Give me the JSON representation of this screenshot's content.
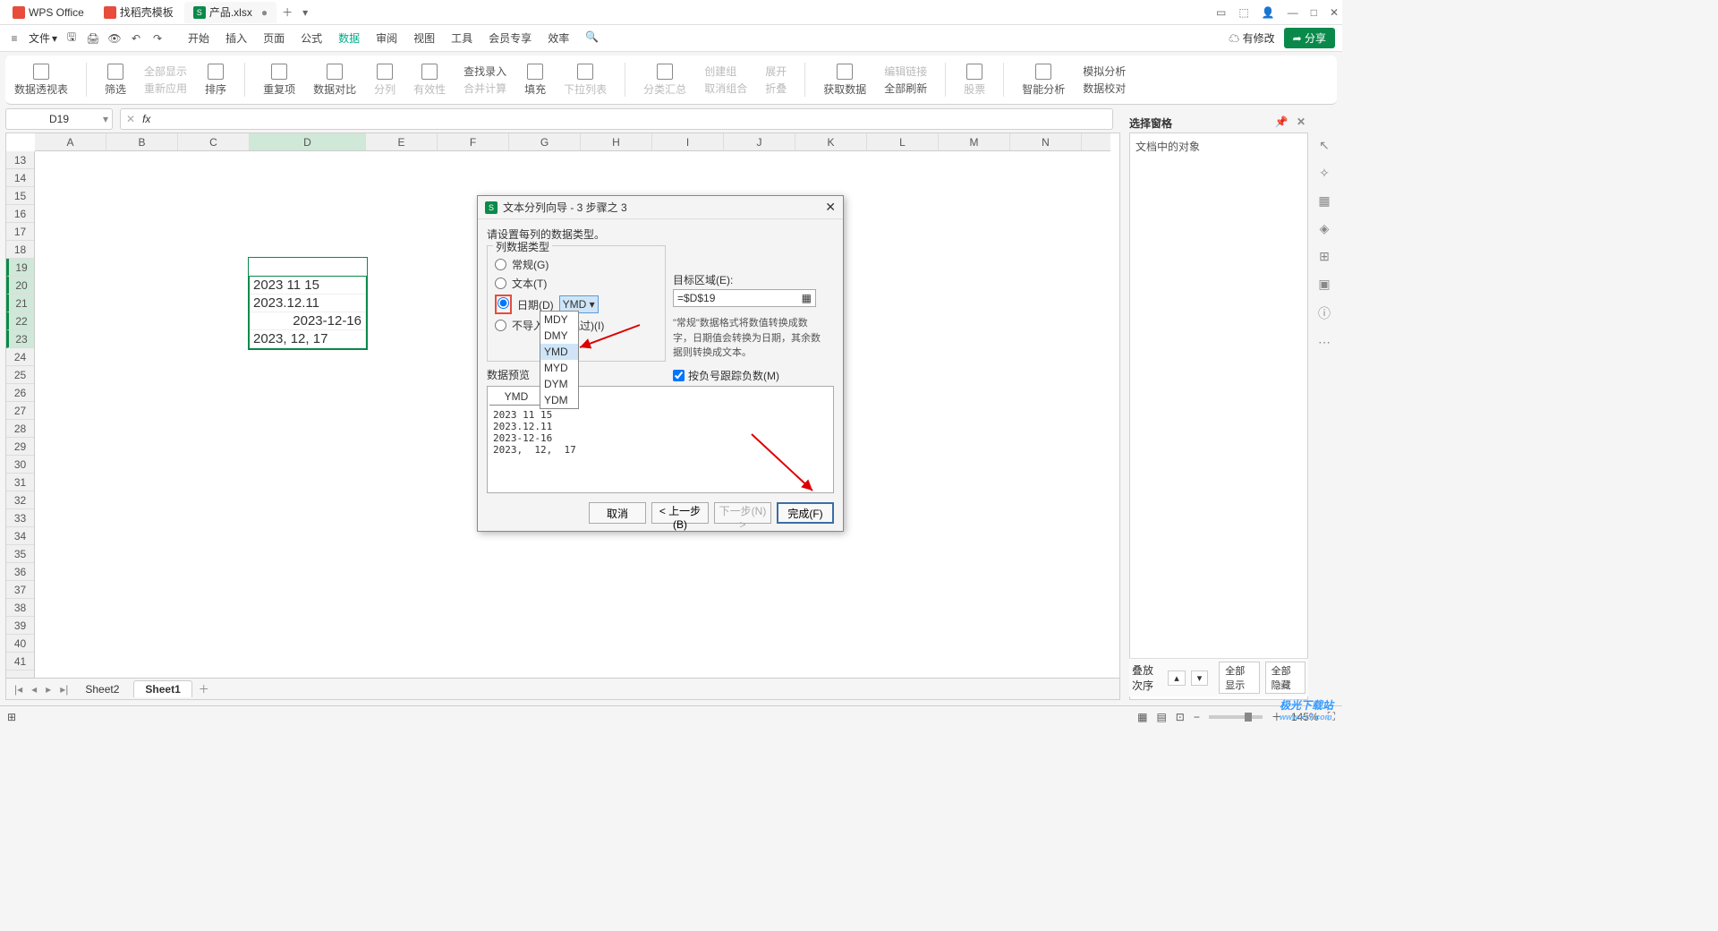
{
  "titlebar": {
    "tabs": [
      {
        "label": "WPS Office"
      },
      {
        "label": "找稻壳模板"
      },
      {
        "label": "产品.xlsx"
      }
    ],
    "modified": "●"
  },
  "menubar": {
    "file": "文件",
    "items": [
      "开始",
      "插入",
      "页面",
      "公式",
      "数据",
      "审阅",
      "视图",
      "工具",
      "会员专享",
      "效率"
    ],
    "active_index": 4,
    "pending": "有修改",
    "share": "分享"
  },
  "ribbon": {
    "g1": "数据透视表",
    "g2a": "筛选",
    "g2b": "全部显示",
    "g2c": "重新应用",
    "g3": "排序",
    "g4": "重复项",
    "g5": "数据对比",
    "g6": "分列",
    "g7": "有效性",
    "g8": "查找录入",
    "g8b": "合并计算",
    "g9": "填充",
    "g10": "下拉列表",
    "g11": "分类汇总",
    "g12": "创建组",
    "g12b": "取消组合",
    "g13": "展开",
    "g13b": "折叠",
    "g14": "获取数据",
    "g15": "编辑链接",
    "g15b": "全部刷新",
    "g16": "股票",
    "g17": "智能分析",
    "g18": "模拟分析",
    "g18b": "数据校对"
  },
  "namebox": "D19",
  "columns": [
    "A",
    "B",
    "C",
    "D",
    "E",
    "F",
    "G",
    "H",
    "I",
    "J",
    "K",
    "L",
    "M",
    "N"
  ],
  "rows": [
    "13",
    "14",
    "15",
    "16",
    "17",
    "18",
    "19",
    "20",
    "21",
    "22",
    "23",
    "24",
    "25",
    "26",
    "27",
    "28",
    "29",
    "30",
    "31",
    "32",
    "33",
    "34",
    "35",
    "36",
    "37",
    "38",
    "39",
    "40",
    "41"
  ],
  "celldata": {
    "d20": "2023 11 15",
    "d21": "2023.12.11",
    "d22": "2023-12-16",
    "d23": "2023, 12, 17"
  },
  "sheets": {
    "s1": "Sheet2",
    "s2": "Sheet1"
  },
  "rightpanel": {
    "title": "选择窗格",
    "sub": "文档中的对象",
    "layer": "叠放次序",
    "showall": "全部显示",
    "hideall": "全部隐藏"
  },
  "dialog": {
    "title": "文本分列向导 - 3 步骤之 3",
    "prompt": "请设置每列的数据类型。",
    "legend": "列数据类型",
    "opt_general": "常规(G)",
    "opt_text": "文本(T)",
    "opt_date": "日期(D)",
    "opt_skip": "不导入此列(跳过)(I)",
    "date_sel": "YMD",
    "dd_items": [
      "MDY",
      "DMY",
      "YMD",
      "MYD",
      "DYM",
      "YDM"
    ],
    "target_lbl": "目标区域(E):",
    "target_val": "=$D$19",
    "info": "\"常规\"数据格式将数值转换成数字，日期值会转换为日期，其余数据则转换成文本。",
    "chk": "按负号跟踪负数(M)",
    "preview_lbl": "数据预览",
    "preview_head": "YMD",
    "preview_body": "2023 11 15\n2023.12.11\n2023-12-16\n2023,  12,  17",
    "btn_cancel": "取消",
    "btn_back": "< 上一步(B)",
    "btn_next": "下一步(N) >",
    "btn_finish": "完成(F)"
  },
  "status": {
    "zoom": "145%"
  },
  "watermark": {
    "t": "极光下载站",
    "u": "www.xz7.com"
  }
}
